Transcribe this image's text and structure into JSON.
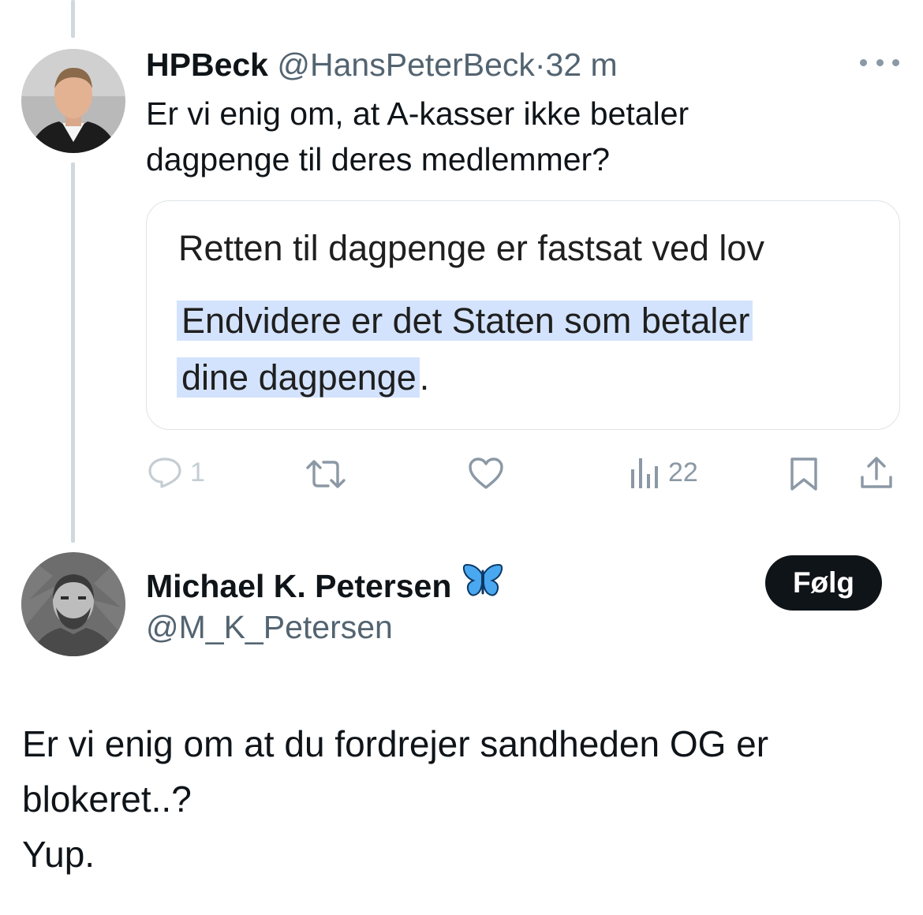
{
  "tweet1": {
    "display_name": "HPBeck",
    "handle": "@HansPeterBeck",
    "separator": "·",
    "time": "32 m",
    "text_line1": "Er vi enig om, at A-kasser ikke betaler",
    "text_line2": "dagpenge til deres medlemmer?",
    "card": {
      "line1": "Retten til dagpenge er fastsat ved lov",
      "highlight_line1": "Endvidere er det Staten som betaler",
      "highlight_line2": "dine dagpenge",
      "highlight_end": "."
    },
    "actions": {
      "reply_count": "1",
      "views_count": "22"
    },
    "more_icon": "more-horizontal-icon"
  },
  "tweet2": {
    "display_name": "Michael K. Petersen",
    "name_emoji": "butterfly-icon",
    "handle": "@M_K_Petersen",
    "follow_label": "Følg",
    "text_line1": "Er vi enig om at du fordrejer sandheden OG er",
    "text_line2": "blokeret..?",
    "text_line3": "Yup."
  },
  "colors": {
    "thread_line": "#cfd9de",
    "muted_text": "#536471",
    "icon_gray": "#8b98a5",
    "highlight": "#d3e3fd",
    "follow_button_bg": "#0f1419",
    "butterfly": "#4aa8f0"
  }
}
